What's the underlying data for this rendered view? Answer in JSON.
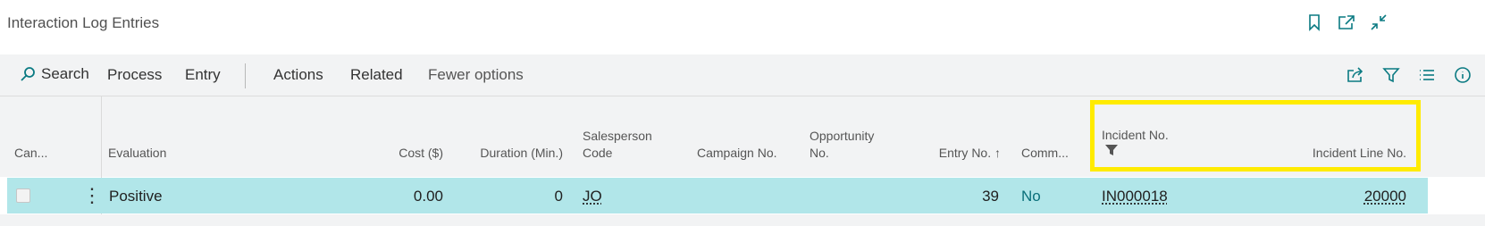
{
  "page": {
    "title": "Interaction Log Entries"
  },
  "window_controls": [
    {
      "name": "bookmark-icon"
    },
    {
      "name": "open-new-window-icon"
    },
    {
      "name": "collapse-icon"
    }
  ],
  "actionbar": {
    "search_label": "Search",
    "process_label": "Process",
    "entry_label": "Entry",
    "actions_label": "Actions",
    "related_label": "Related",
    "fewer_options_label": "Fewer options",
    "icons": [
      "share-icon",
      "filter-icon",
      "list-view-icon",
      "info-icon"
    ]
  },
  "columns": {
    "canceled": "Can...",
    "evaluation": "Evaluation",
    "cost": "Cost ($)",
    "duration": "Duration (Min.)",
    "salesperson_line1": "Salesperson",
    "salesperson_line2": "Code",
    "campaign": "Campaign No.",
    "opportunity_line1": "Opportunity",
    "opportunity_line2": "No.",
    "entry_no": "Entry No. ↑",
    "comment": "Comm...",
    "incident_no": "Incident No.",
    "incident_line_no": "Incident Line No."
  },
  "rows": [
    {
      "evaluation": "Positive",
      "cost": "0.00",
      "duration": "0",
      "salesperson": "JO",
      "campaign": "",
      "opportunity": "",
      "entry_no": "39",
      "comment": "No",
      "incident_no": "IN000018",
      "incident_line_no": "20000"
    }
  ],
  "colors": {
    "accent": "#0a7a82",
    "selected_row": "#b1e6e9",
    "highlight": "#ffeb00"
  }
}
